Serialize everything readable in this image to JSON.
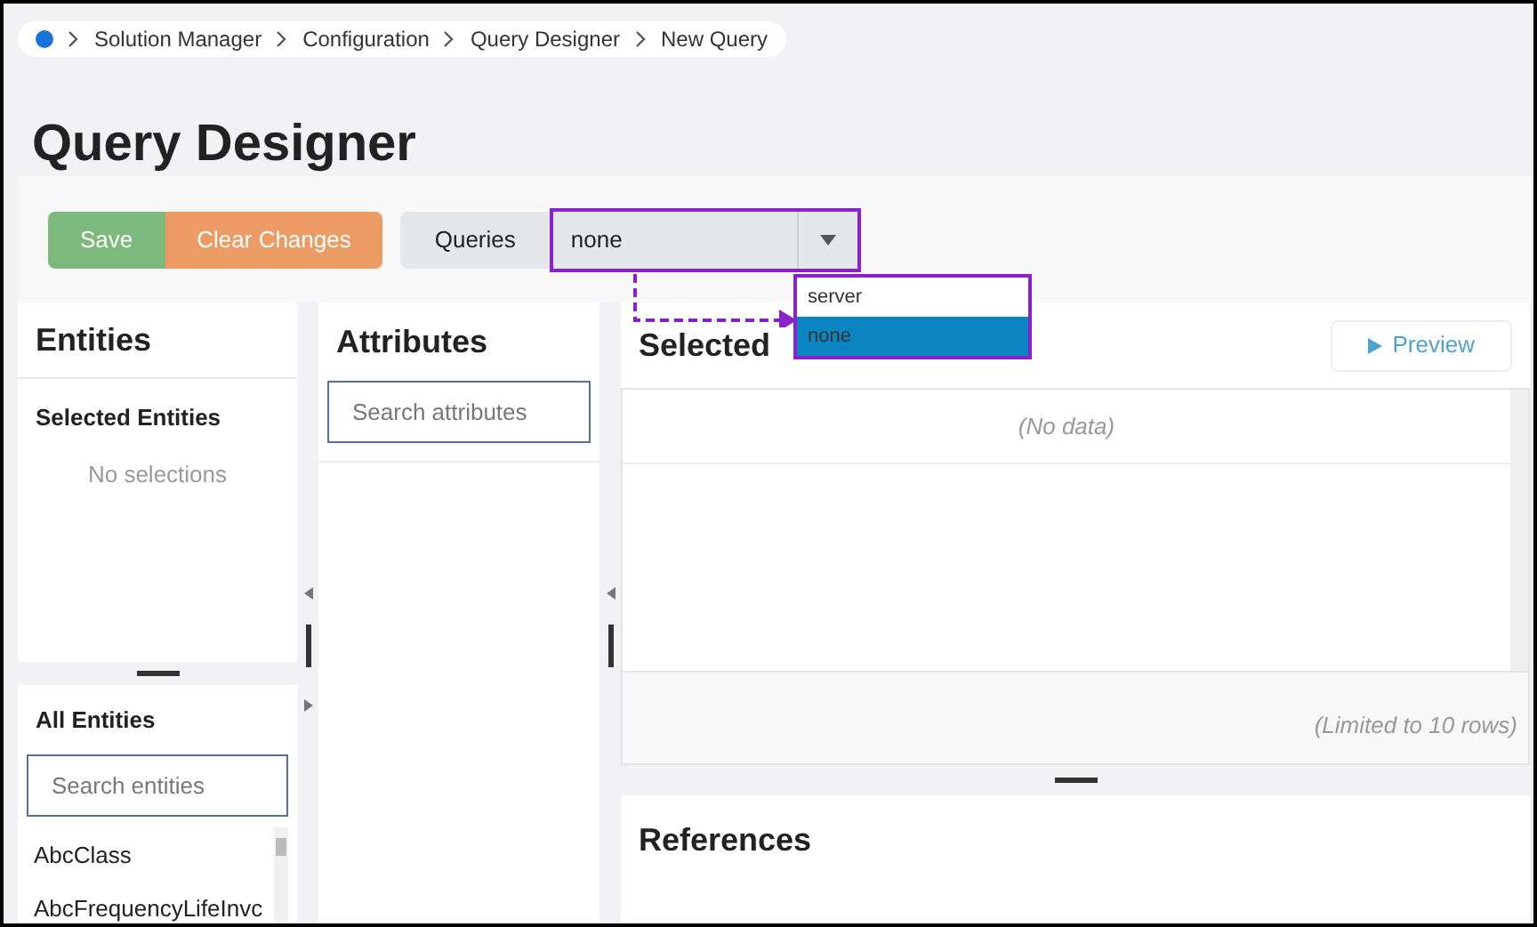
{
  "breadcrumb": {
    "items": [
      "Solution Manager",
      "Configuration",
      "Query Designer",
      "New Query"
    ]
  },
  "page_title": "Query Designer",
  "toolbar": {
    "buttons": [
      {
        "label": "Save",
        "kind": "save"
      },
      {
        "label": "Clear Changes",
        "kind": "clear"
      }
    ],
    "queries": {
      "label": "Queries",
      "value": "none",
      "options": [
        {
          "label": "server",
          "selected": false
        },
        {
          "label": "none",
          "selected": true
        }
      ]
    }
  },
  "entities": {
    "title": "Entities",
    "selected_title": "Selected Entities",
    "empty_text": "No selections",
    "all_title": "All Entities",
    "search": {
      "placeholder": "Search entities"
    },
    "items": [
      "AbcClass",
      "AbcFrequencyLifeInvc"
    ]
  },
  "attributes": {
    "title": "Attributes",
    "search": {
      "placeholder": "Search attributes"
    }
  },
  "selected_attributes": {
    "title": "Selected",
    "preview": "Preview",
    "empty_text": "(No data)",
    "limit_text": "(Limited to 10 rows)"
  },
  "references": {
    "title": "References"
  }
}
